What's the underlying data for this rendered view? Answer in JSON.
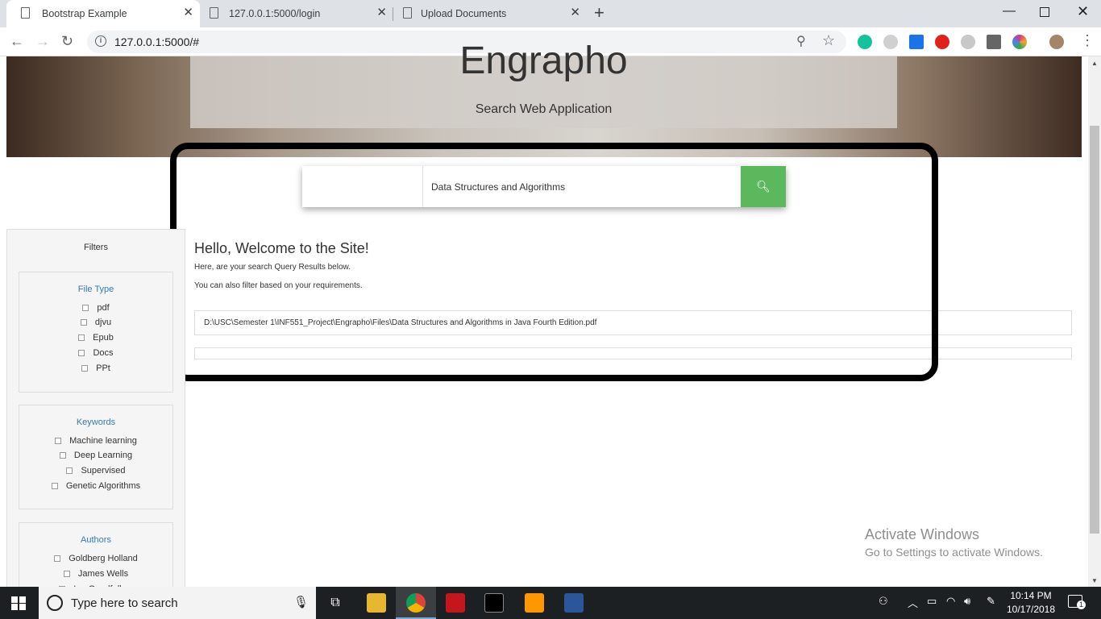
{
  "browser": {
    "tabs": [
      {
        "title": "Bootstrap Example",
        "active": true
      },
      {
        "title": "127.0.0.1:5000/login",
        "active": false
      },
      {
        "title": "Upload Documents",
        "active": false
      }
    ],
    "url": "127.0.0.1:5000/#",
    "extensions": [
      {
        "name": "grammarly-icon",
        "color": "#15c39a"
      },
      {
        "name": "extension-gray-icon",
        "color": "#b0b0b0"
      },
      {
        "name": "new-badge-icon",
        "color": "#1a73e8",
        "badge": "New"
      },
      {
        "name": "opera-icon",
        "color": "#e0201b"
      },
      {
        "name": "bike-icon",
        "color": "#888888"
      },
      {
        "name": "megaphone-icon",
        "color": "#555555"
      },
      {
        "name": "colorful-extension-icon",
        "color": "#d4358e"
      }
    ]
  },
  "hero": {
    "title": "Engrapho",
    "subtitle": "Search Web Application"
  },
  "search": {
    "value": "Data Structures and Algorithms",
    "button_color": "#5cb85c"
  },
  "main": {
    "heading": "Hello, Welcome to the Site!",
    "line1": "Here, are your search Query Results below.",
    "line2": "You can also filter based on your requirements.",
    "results": [
      "D:\\USC\\Semester 1\\INF551_Project\\Engrapho\\Files\\Data Structures and Algorithms in Java Fourth Edition.pdf"
    ]
  },
  "filters": {
    "title": "Filters",
    "groups": [
      {
        "title": "File Type",
        "options": [
          "pdf",
          "djvu",
          "Epub",
          "Docs",
          "PPt"
        ]
      },
      {
        "title": "Keywords",
        "options": [
          "Machine learning",
          "Deep Learning",
          "Supervised",
          "Genetic Algorithms"
        ]
      },
      {
        "title": "Authors",
        "options": [
          "Goldberg Holland",
          "James Wells",
          "Ian Goodfellow"
        ]
      }
    ]
  },
  "watermark": {
    "line1": "Activate Windows",
    "line2": "Go to Settings to activate Windows."
  },
  "taskbar": {
    "search_placeholder": "Type here to search",
    "time": "10:14 PM",
    "date": "10/17/2018",
    "notification_count": "1"
  }
}
